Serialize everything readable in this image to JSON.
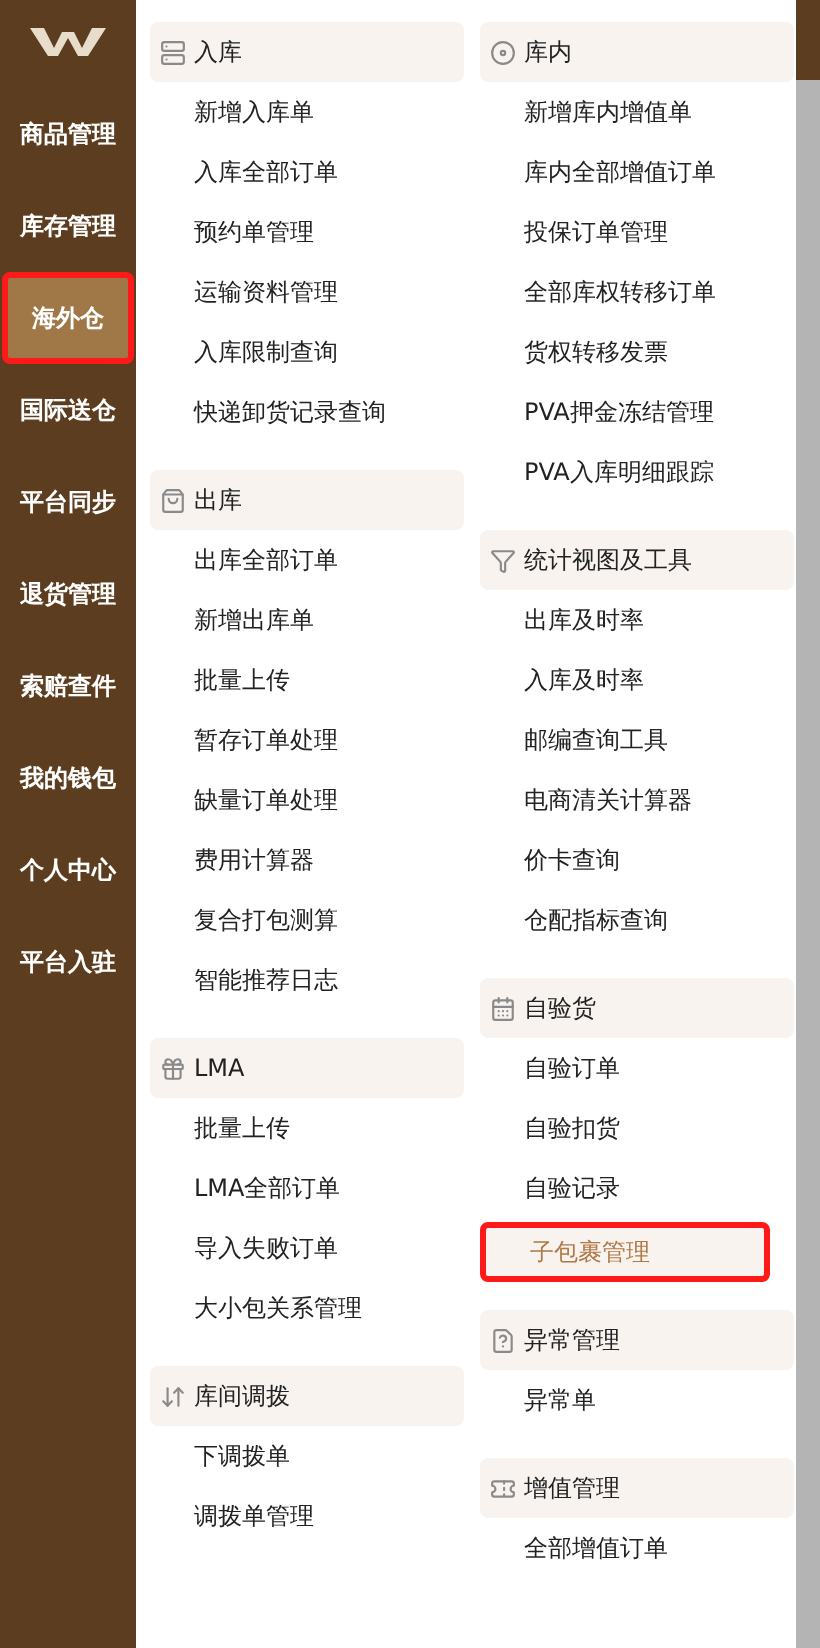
{
  "sidebar": {
    "items": [
      {
        "label": "商品管理",
        "selected": false
      },
      {
        "label": "库存管理",
        "selected": false
      },
      {
        "label": "海外仓",
        "selected": true
      },
      {
        "label": "国际送仓",
        "selected": false
      },
      {
        "label": "平台同步",
        "selected": false
      },
      {
        "label": "退货管理",
        "selected": false
      },
      {
        "label": "索赔查件",
        "selected": false
      },
      {
        "label": "我的钱包",
        "selected": false
      },
      {
        "label": "个人中心",
        "selected": false
      },
      {
        "label": "平台入驻",
        "selected": false
      }
    ]
  },
  "menu": {
    "columns": [
      {
        "sections": [
          {
            "title": "入库",
            "kind": "server",
            "items": [
              {
                "label": "新增入库单",
                "selected": false
              },
              {
                "label": "入库全部订单",
                "selected": false
              },
              {
                "label": "预约单管理",
                "selected": false
              },
              {
                "label": "运输资料管理",
                "selected": false
              },
              {
                "label": "入库限制查询",
                "selected": false
              },
              {
                "label": "快递卸货记录查询",
                "selected": false
              }
            ]
          },
          {
            "title": "出库",
            "kind": "bag",
            "items": [
              {
                "label": "出库全部订单",
                "selected": false
              },
              {
                "label": "新增出库单",
                "selected": false
              },
              {
                "label": "批量上传",
                "selected": false
              },
              {
                "label": "暂存订单处理",
                "selected": false
              },
              {
                "label": "缺量订单处理",
                "selected": false
              },
              {
                "label": "费用计算器",
                "selected": false
              },
              {
                "label": "复合打包测算",
                "selected": false
              },
              {
                "label": "智能推荐日志",
                "selected": false
              }
            ]
          },
          {
            "title": "LMA",
            "kind": "gift",
            "items": [
              {
                "label": "批量上传",
                "selected": false
              },
              {
                "label": "LMA全部订单",
                "selected": false
              },
              {
                "label": "导入失败订单",
                "selected": false
              },
              {
                "label": "大小包关系管理",
                "selected": false
              }
            ]
          },
          {
            "title": "库间调拨",
            "kind": "transfer",
            "items": [
              {
                "label": "下调拨单",
                "selected": false
              },
              {
                "label": "调拨单管理",
                "selected": false
              }
            ]
          }
        ]
      },
      {
        "sections": [
          {
            "title": "库内",
            "kind": "disc",
            "items": [
              {
                "label": "新增库内增值单",
                "selected": false
              },
              {
                "label": "库内全部增值订单",
                "selected": false
              },
              {
                "label": "投保订单管理",
                "selected": false
              },
              {
                "label": "全部库权转移订单",
                "selected": false
              },
              {
                "label": "货权转移发票",
                "selected": false
              },
              {
                "label": "PVA押金冻结管理",
                "selected": false
              },
              {
                "label": "PVA入库明细跟踪",
                "selected": false
              }
            ]
          },
          {
            "title": "统计视图及工具",
            "kind": "filter",
            "items": [
              {
                "label": "出库及时率",
                "selected": false
              },
              {
                "label": "入库及时率",
                "selected": false
              },
              {
                "label": "邮编查询工具",
                "selected": false
              },
              {
                "label": "电商清关计算器",
                "selected": false
              },
              {
                "label": "价卡查询",
                "selected": false
              },
              {
                "label": "仓配指标查询",
                "selected": false
              }
            ]
          },
          {
            "title": "自验货",
            "kind": "calendar",
            "items": [
              {
                "label": "自验订单",
                "selected": false
              },
              {
                "label": "自验扣货",
                "selected": false
              },
              {
                "label": "自验记录",
                "selected": false
              },
              {
                "label": "子包裹管理",
                "selected": true
              }
            ]
          },
          {
            "title": "异常管理",
            "kind": "file",
            "items": [
              {
                "label": "异常单",
                "selected": false
              }
            ]
          },
          {
            "title": "增值管理",
            "kind": "ticket",
            "items": [
              {
                "label": "全部增值订单",
                "selected": false
              }
            ]
          }
        ]
      }
    ]
  }
}
